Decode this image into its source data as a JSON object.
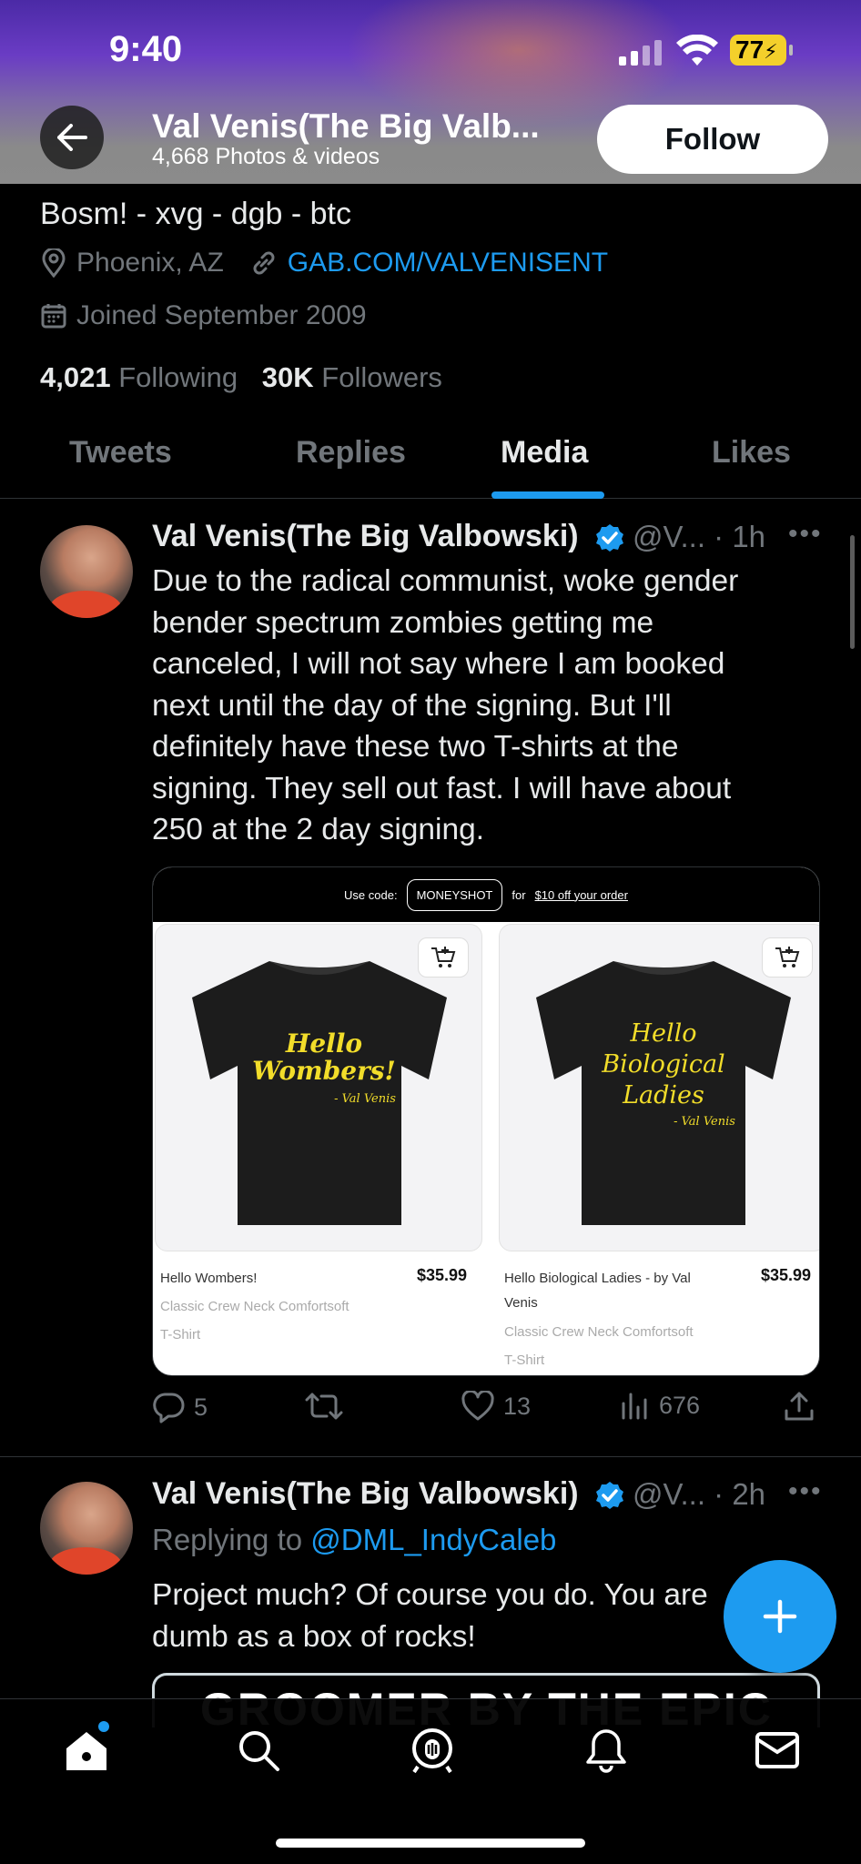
{
  "status_bar": {
    "time": "9:40",
    "battery": "77"
  },
  "header": {
    "name": "Val Venis(The Big Valb...",
    "subtitle": "4,668 Photos & videos",
    "follow_label": "Follow"
  },
  "profile": {
    "bio_tail": "Bosm! - xvg - dgb - btc",
    "location": "Phoenix, AZ",
    "website": "GAB.COM/VALVENISENT",
    "joined": "Joined September 2009",
    "following_count": "4,021",
    "following_label": "Following",
    "followers_count": "30K",
    "followers_label": "Followers"
  },
  "tabs": [
    {
      "label": "Tweets",
      "active": false
    },
    {
      "label": "Replies",
      "active": false
    },
    {
      "label": "Media",
      "active": true
    },
    {
      "label": "Likes",
      "active": false
    }
  ],
  "tweets": [
    {
      "author": "Val Venis(The Big Valbowski)",
      "handle_time": "@V... · 1h",
      "text": "Due to the radical communist, woke gender bender spectrum zombies getting me canceled, I will not say where I am booked next until the day of the signing. But I'll definitely have these two T-shirts at the signing. They sell out fast. I will have about 250 at the 2 day signing.",
      "media": {
        "promo_prefix": "Use code:",
        "promo_code": "MONEYSHOT",
        "promo_for": "for",
        "promo_link": "$10 off your order",
        "products": [
          {
            "shirt_text_1": "Hello",
            "shirt_text_2": "Wombers!",
            "shirt_sig": "- Val Venis",
            "title": "Hello Wombers!",
            "price": "$35.99",
            "sub_1": "Classic Crew Neck Comfortsoft",
            "sub_2": "T-Shirt"
          },
          {
            "shirt_text_1": "Hello",
            "shirt_text_2": "Biological",
            "shirt_text_3": "Ladies",
            "shirt_sig": "- Val Venis",
            "title_1": "Hello Biological Ladies - by Val",
            "title_2": "Venis",
            "price": "$35.99",
            "sub_1": "Classic Crew Neck Comfortsoft",
            "sub_2": "T-Shirt"
          }
        ]
      },
      "replies": "5",
      "likes": "13",
      "views": "676"
    },
    {
      "author": "Val Venis(The Big Valbowski)",
      "handle_time": "@V... · 2h",
      "replying_prefix": "Replying to",
      "replying_to": "@DML_IndyCaleb",
      "text": "Project much? Of course you do. You are dumb as a box of rocks!",
      "card_preview": "GROOMER BY THE EPIC"
    }
  ],
  "colors": {
    "accent": "#1d9bf0",
    "background": "#000000",
    "muted": "#71767b",
    "text": "#e7e9ea",
    "shirt_ink": "#f2dd2a"
  },
  "icons": [
    "back-arrow-icon",
    "location-pin-icon",
    "link-icon",
    "calendar-icon",
    "verified-badge-icon",
    "more-icon",
    "reply-icon",
    "retweet-icon",
    "like-icon",
    "views-icon",
    "share-icon",
    "cart-icon",
    "compose-icon",
    "home-icon",
    "search-icon",
    "spaces-icon",
    "notifications-icon",
    "messages-icon"
  ]
}
